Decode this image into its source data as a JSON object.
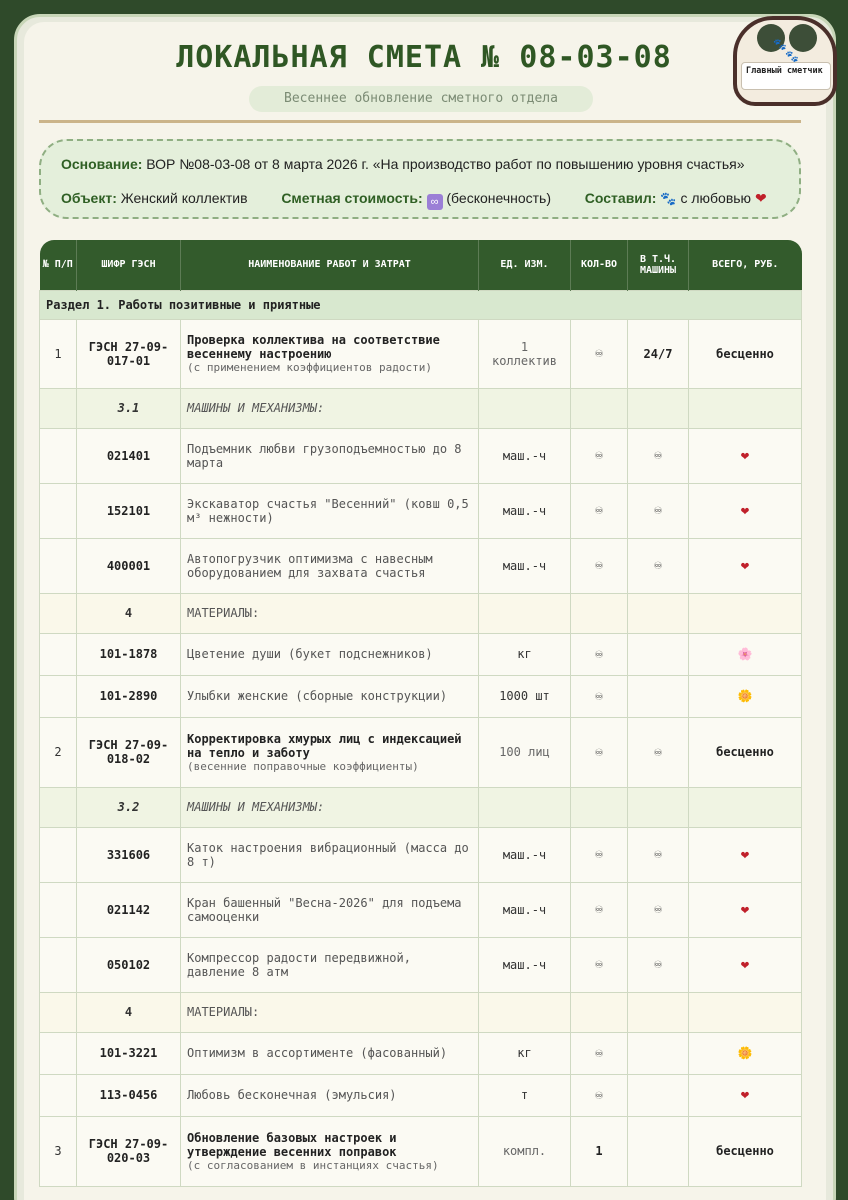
{
  "header": {
    "title": "ЛОКАЛЬНАЯ СМЕТА № 08-03-08",
    "subtitle": "Весеннее обновление сметного отдела",
    "badge_label": "Главный сметчик"
  },
  "info": {
    "basis_label": "Основание:",
    "basis_value": "ВОР №08-03-08 от 8 марта 2026 г. «На производство работ по повышению уровня счастья»",
    "object_label": "Объект:",
    "object_value": "Женский коллектив",
    "cost_label": "Сметная стоимость:",
    "cost_value": "(бесконечность)",
    "author_label": "Составил:",
    "author_value": "с любовью"
  },
  "table": {
    "headers": [
      "№ П/П",
      "ШИФР ГЭСН",
      "НАИМЕНОВАНИЕ РАБОТ И ЗАТРАТ",
      "ЕД. ИЗМ.",
      "КОЛ-ВО",
      "В Т.Ч. МАШИНЫ",
      "ВСЕГО, РУБ."
    ],
    "section1": "Раздел 1. Работы позитивные и приятные",
    "item1": {
      "num": "1",
      "code": "ГЭСН 27-09-017-01",
      "name": "Проверка коллектива на соответствие весеннему настроению",
      "note": "(с применением коэффициентов радости)",
      "unit": "1 коллектив",
      "qty": "♾",
      "mach": "24/7",
      "total": "бесценно"
    },
    "group1": {
      "num": "3.1",
      "name": "МАШИНЫ И МЕХАНИЗМЫ:"
    },
    "m1": [
      {
        "code": "021401",
        "name": "Подъемник любви грузоподъемностью до 8 марта",
        "unit": "маш.-ч",
        "qty": "♾",
        "mach": "♾",
        "total": "❤"
      },
      {
        "code": "152101",
        "name": "Экскаватор счастья \"Весенний\" (ковш 0,5 м³ нежности)",
        "unit": "маш.-ч",
        "qty": "♾",
        "mach": "♾",
        "total": "❤"
      },
      {
        "code": "400001",
        "name": "Автопогрузчик оптимизма с навесным оборудованием для захвата счастья",
        "unit": "маш.-ч",
        "qty": "♾",
        "mach": "♾",
        "total": "❤"
      }
    ],
    "mat1": {
      "num": "4",
      "name": "МАТЕРИАЛЫ:"
    },
    "mt1": [
      {
        "code": "101-1878",
        "name": "Цветение души (букет подснежников)",
        "unit": "кг",
        "qty": "♾",
        "total": "🌸"
      },
      {
        "code": "101-2890",
        "name": "Улыбки женские (сборные конструкции)",
        "unit": "1000 шт",
        "qty": "♾",
        "total": "🌼"
      }
    ],
    "item2": {
      "num": "2",
      "code": "ГЭСН 27-09-018-02",
      "name": "Корректировка хмурых лиц с индексацией на тепло и заботу",
      "note": "(весенние поправочные коэффициенты)",
      "unit": "100 лиц",
      "qty": "♾",
      "mach": "♾",
      "total": "бесценно"
    },
    "group2": {
      "num": "3.2",
      "name": "МАШИНЫ И МЕХАНИЗМЫ:"
    },
    "m2": [
      {
        "code": "331606",
        "name": "Каток настроения вибрационный (масса до 8 т)",
        "unit": "маш.-ч",
        "qty": "♾",
        "mach": "♾",
        "total": "❤"
      },
      {
        "code": "021142",
        "name": "Кран башенный \"Весна-2026\" для подъема самооценки",
        "unit": "маш.-ч",
        "qty": "♾",
        "mach": "♾",
        "total": "❤"
      },
      {
        "code": "050102",
        "name": "Компрессор радости передвижной, давление 8 атм",
        "unit": "маш.-ч",
        "qty": "♾",
        "mach": "♾",
        "total": "❤"
      }
    ],
    "mat2": {
      "num": "4",
      "name": "МАТЕРИАЛЫ:"
    },
    "mt2": [
      {
        "code": "101-3221",
        "name": "Оптимизм в ассортименте (фасованный)",
        "unit": "кг",
        "qty": "♾",
        "total": "🌼"
      },
      {
        "code": "113-0456",
        "name": "Любовь бесконечная (эмульсия)",
        "unit": "т",
        "qty": "♾",
        "total": "❤"
      }
    ],
    "item3": {
      "num": "3",
      "code": "ГЭСН 27-09-020-03",
      "name": "Обновление базовых настроек и утверждение весенних поправок",
      "note": "(с согласованием в инстанциях счастья)",
      "unit": "компл.",
      "qty": "1",
      "mach": "",
      "total": "бесценно"
    }
  }
}
